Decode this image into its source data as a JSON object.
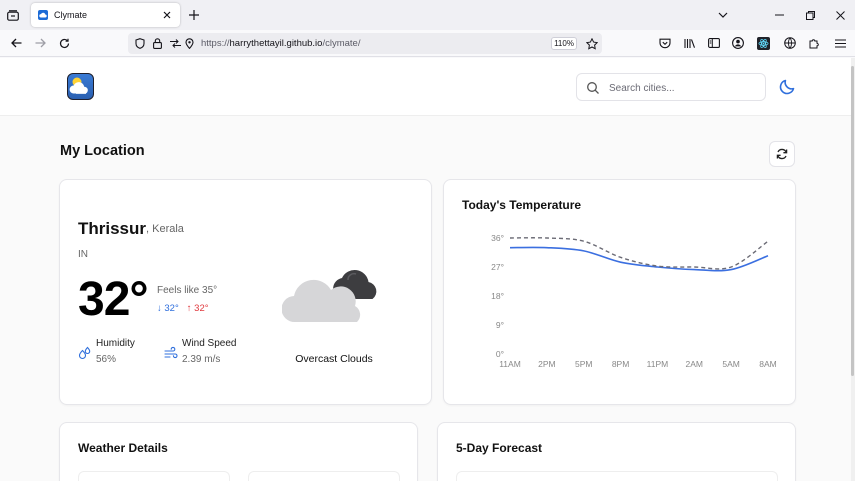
{
  "browser": {
    "tab_title": "Clymate",
    "url_prefix": "https://",
    "url_host": "harrythettayil.github.io",
    "url_path": "/clymate/",
    "zoom": "110%"
  },
  "header": {
    "search_placeholder": "Search cities..."
  },
  "section": {
    "title": "My Location"
  },
  "current": {
    "city": "Thrissur",
    "region": ", Kerala",
    "country": "IN",
    "temp": "32°",
    "feels_like": "Feels like 35°",
    "min": "↓ 32°",
    "max": "↑ 32°",
    "humidity_label": "Humidity",
    "humidity_value": "56%",
    "wind_label": "Wind Speed",
    "wind_value": "2.39 m/s",
    "condition": "Overcast Clouds"
  },
  "temperature_card": {
    "title": "Today's Temperature"
  },
  "details_card": {
    "title": "Weather Details"
  },
  "forecast_card": {
    "title": "5-Day Forecast"
  },
  "colors": {
    "accent": "#2f6fdc",
    "max_red": "#e0393e",
    "temp_line": "#3b6fe0",
    "feels_line": "#6b6b75"
  },
  "chart_data": {
    "type": "line",
    "categories": [
      "11AM",
      "2PM",
      "5PM",
      "8PM",
      "11PM",
      "2AM",
      "5AM",
      "8AM"
    ],
    "series": [
      {
        "values": [
          33,
          33,
          32,
          28.5,
          27,
          26.2,
          26.2,
          30.5
        ]
      },
      {
        "values": [
          36,
          36,
          35,
          30,
          27.3,
          27,
          27,
          35
        ]
      }
    ],
    "yticks": [
      "0°",
      "9°",
      "18°",
      "27°",
      "36°"
    ],
    "ylim": [
      0,
      36
    ],
    "grid": false
  }
}
